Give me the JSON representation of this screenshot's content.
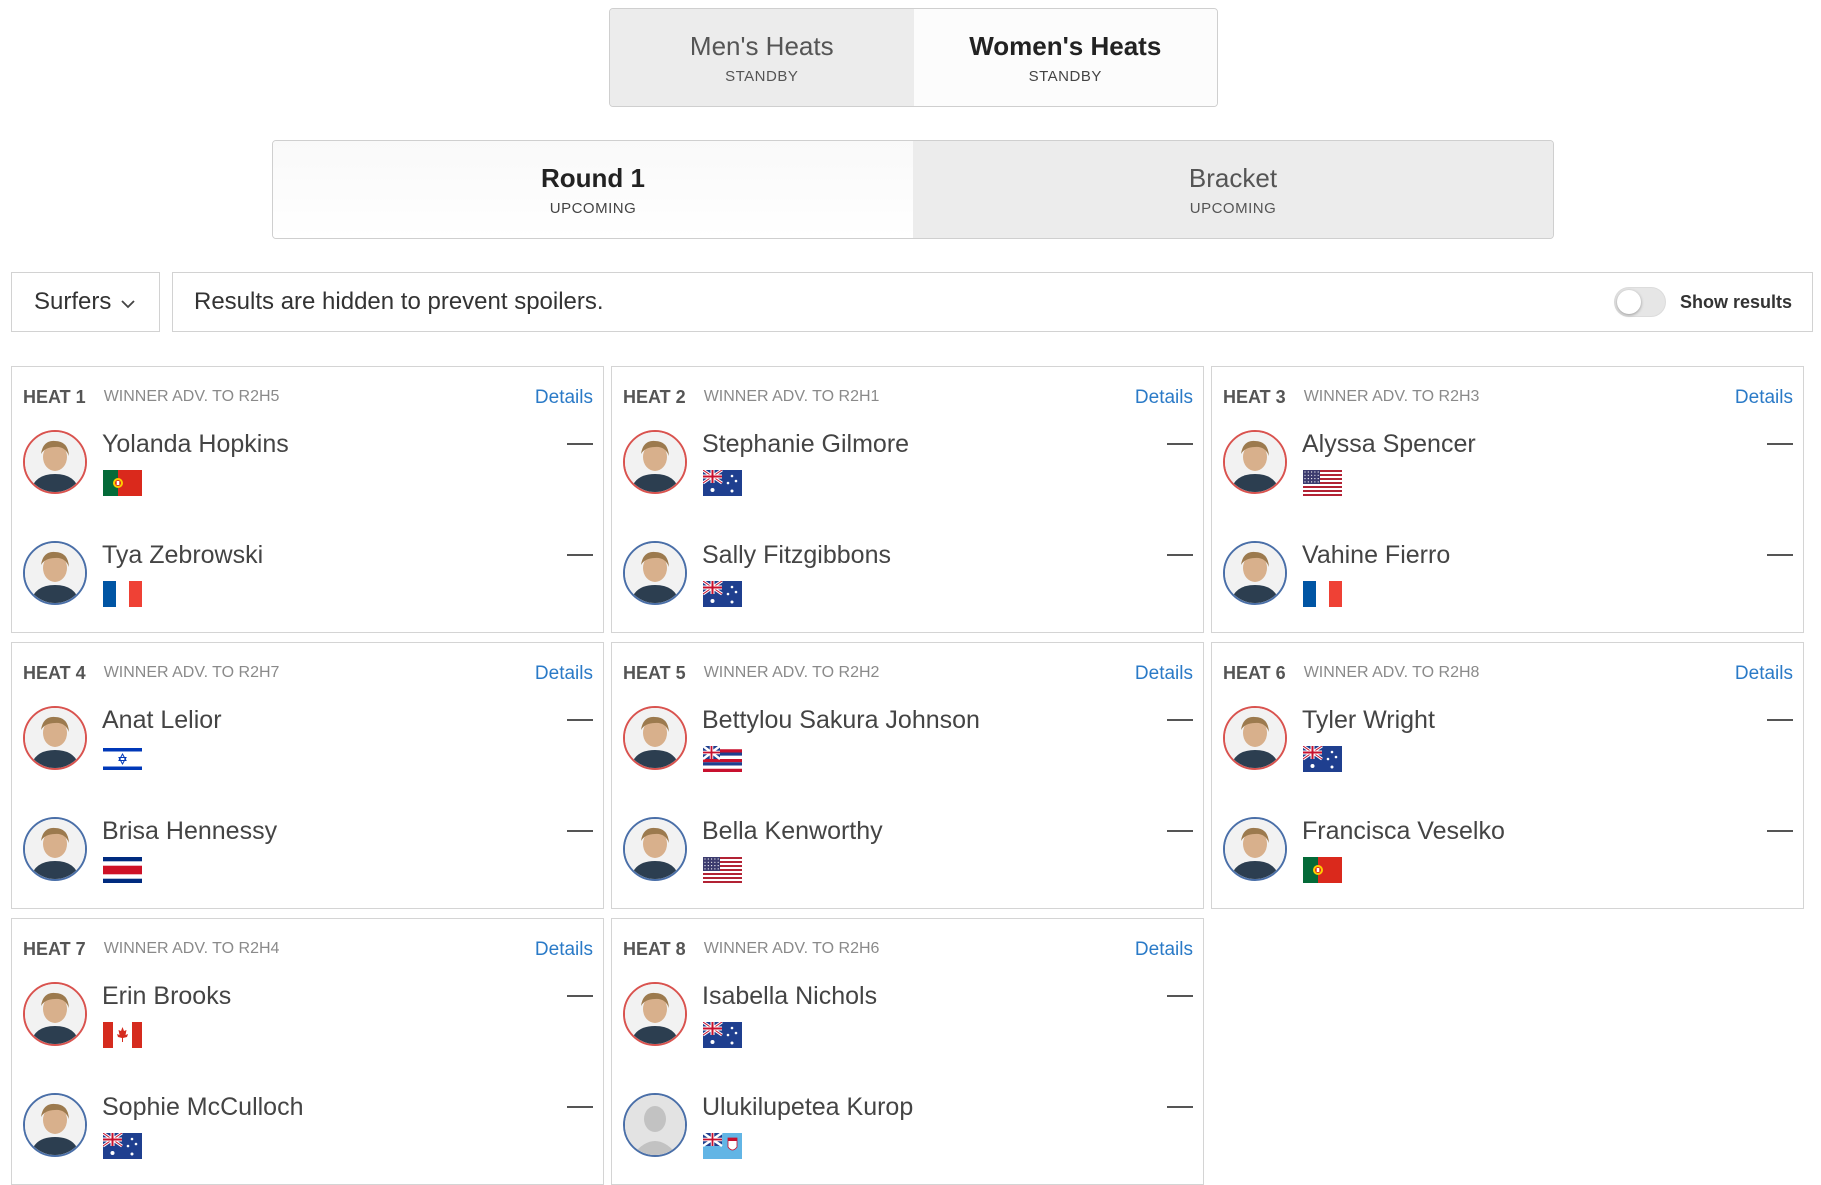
{
  "gender_tabs": [
    {
      "label": "Men's Heats",
      "status": "STANDBY",
      "selected": false
    },
    {
      "label": "Women's Heats",
      "status": "STANDBY",
      "selected": true
    }
  ],
  "round_tabs": [
    {
      "label": "Round 1",
      "status": "UPCOMING",
      "selected": true
    },
    {
      "label": "Bracket",
      "status": "UPCOMING",
      "selected": false
    }
  ],
  "filter": {
    "dropdown_label": "Surfers",
    "spoiler_message": "Results are hidden to prevent spoilers.",
    "toggle_label": "Show results",
    "toggle_on": false
  },
  "colors": {
    "red_ring": "#d9534f",
    "blue_ring": "#4a6fa8",
    "link": "#2a7ac7"
  },
  "heats": [
    {
      "title": "HEAT 1",
      "advance": "WINNER ADV. TO R2H5",
      "details": "Details",
      "surfers": [
        {
          "name": "Yolanda Hopkins",
          "flag": "portugal",
          "score": "—"
        },
        {
          "name": "Tya Zebrowski",
          "flag": "france",
          "score": "—"
        }
      ]
    },
    {
      "title": "HEAT 2",
      "advance": "WINNER ADV. TO R2H1",
      "details": "Details",
      "surfers": [
        {
          "name": "Stephanie Gilmore",
          "flag": "australia",
          "score": "—"
        },
        {
          "name": "Sally Fitzgibbons",
          "flag": "australia",
          "score": "—"
        }
      ]
    },
    {
      "title": "HEAT 3",
      "advance": "WINNER ADV. TO R2H3",
      "details": "Details",
      "surfers": [
        {
          "name": "Alyssa Spencer",
          "flag": "usa",
          "score": "—"
        },
        {
          "name": "Vahine Fierro",
          "flag": "france",
          "score": "—"
        }
      ]
    },
    {
      "title": "HEAT 4",
      "advance": "WINNER ADV. TO R2H7",
      "details": "Details",
      "surfers": [
        {
          "name": "Anat Lelior",
          "flag": "israel",
          "score": "—"
        },
        {
          "name": "Brisa Hennessy",
          "flag": "costa-rica",
          "score": "—"
        }
      ]
    },
    {
      "title": "HEAT 5",
      "advance": "WINNER ADV. TO R2H2",
      "details": "Details",
      "surfers": [
        {
          "name": "Bettylou Sakura Johnson",
          "flag": "hawaii",
          "score": "—"
        },
        {
          "name": "Bella Kenworthy",
          "flag": "usa",
          "score": "—"
        }
      ]
    },
    {
      "title": "HEAT 6",
      "advance": "WINNER ADV. TO R2H8",
      "details": "Details",
      "surfers": [
        {
          "name": "Tyler Wright",
          "flag": "australia",
          "score": "—"
        },
        {
          "name": "Francisca Veselko",
          "flag": "portugal",
          "score": "—"
        }
      ]
    },
    {
      "title": "HEAT 7",
      "advance": "WINNER ADV. TO R2H4",
      "details": "Details",
      "surfers": [
        {
          "name": "Erin Brooks",
          "flag": "canada",
          "score": "—"
        },
        {
          "name": "Sophie McCulloch",
          "flag": "australia",
          "score": "—"
        }
      ]
    },
    {
      "title": "HEAT 8",
      "advance": "WINNER ADV. TO R2H6",
      "details": "Details",
      "surfers": [
        {
          "name": "Isabella Nichols",
          "flag": "australia",
          "score": "—"
        },
        {
          "name": "Ulukilupetea Kurop",
          "flag": "fiji",
          "score": "—"
        }
      ]
    }
  ]
}
